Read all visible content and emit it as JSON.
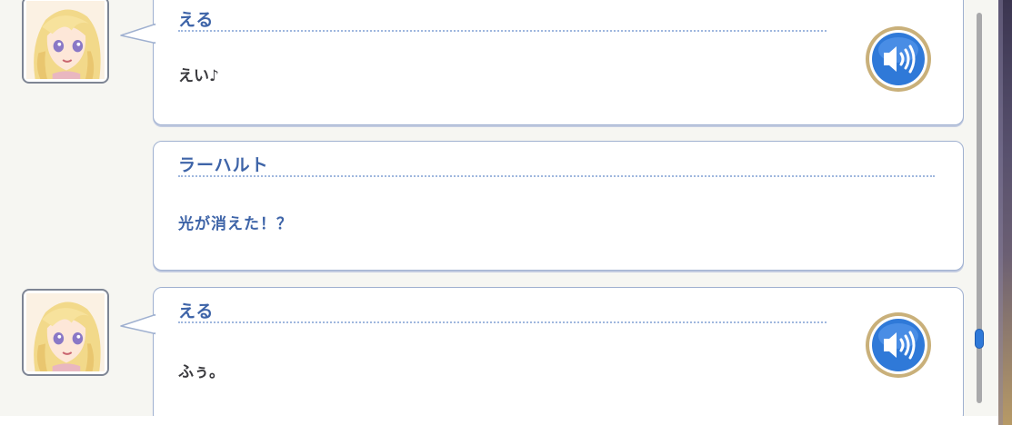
{
  "log": {
    "entries": [
      {
        "speaker": "える",
        "text": "えい♪",
        "has_avatar": true,
        "has_voice": true
      },
      {
        "speaker": "ラーハルト",
        "text": "光が消えた！？",
        "has_avatar": false,
        "has_voice": false
      },
      {
        "speaker": "える",
        "text": "ふぅ。",
        "has_avatar": true,
        "has_voice": true
      }
    ]
  },
  "icons": {
    "avatar": "character-portrait-icon",
    "voice": "speaker-play-icon"
  },
  "colors": {
    "speaker_name": "#3e64a8",
    "voice_button": "#2f79d8",
    "scroll_thumb": "#2f79d8"
  },
  "scroll": {
    "position": 0.86
  }
}
